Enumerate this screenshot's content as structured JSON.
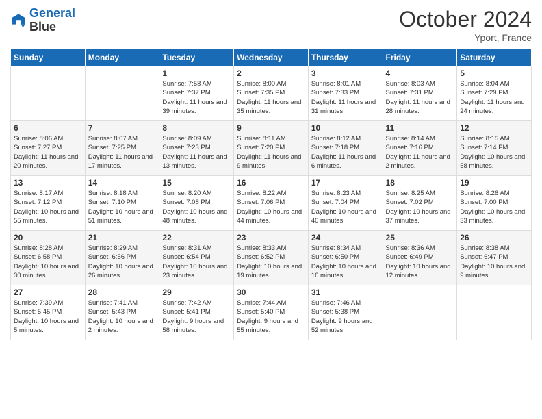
{
  "header": {
    "logo_line1": "General",
    "logo_line2": "Blue",
    "month": "October 2024",
    "location": "Yport, France"
  },
  "weekdays": [
    "Sunday",
    "Monday",
    "Tuesday",
    "Wednesday",
    "Thursday",
    "Friday",
    "Saturday"
  ],
  "weeks": [
    [
      {
        "day": "",
        "sunrise": "",
        "sunset": "",
        "daylight": ""
      },
      {
        "day": "",
        "sunrise": "",
        "sunset": "",
        "daylight": ""
      },
      {
        "day": "1",
        "sunrise": "Sunrise: 7:58 AM",
        "sunset": "Sunset: 7:37 PM",
        "daylight": "Daylight: 11 hours and 39 minutes."
      },
      {
        "day": "2",
        "sunrise": "Sunrise: 8:00 AM",
        "sunset": "Sunset: 7:35 PM",
        "daylight": "Daylight: 11 hours and 35 minutes."
      },
      {
        "day": "3",
        "sunrise": "Sunrise: 8:01 AM",
        "sunset": "Sunset: 7:33 PM",
        "daylight": "Daylight: 11 hours and 31 minutes."
      },
      {
        "day": "4",
        "sunrise": "Sunrise: 8:03 AM",
        "sunset": "Sunset: 7:31 PM",
        "daylight": "Daylight: 11 hours and 28 minutes."
      },
      {
        "day": "5",
        "sunrise": "Sunrise: 8:04 AM",
        "sunset": "Sunset: 7:29 PM",
        "daylight": "Daylight: 11 hours and 24 minutes."
      }
    ],
    [
      {
        "day": "6",
        "sunrise": "Sunrise: 8:06 AM",
        "sunset": "Sunset: 7:27 PM",
        "daylight": "Daylight: 11 hours and 20 minutes."
      },
      {
        "day": "7",
        "sunrise": "Sunrise: 8:07 AM",
        "sunset": "Sunset: 7:25 PM",
        "daylight": "Daylight: 11 hours and 17 minutes."
      },
      {
        "day": "8",
        "sunrise": "Sunrise: 8:09 AM",
        "sunset": "Sunset: 7:23 PM",
        "daylight": "Daylight: 11 hours and 13 minutes."
      },
      {
        "day": "9",
        "sunrise": "Sunrise: 8:11 AM",
        "sunset": "Sunset: 7:20 PM",
        "daylight": "Daylight: 11 hours and 9 minutes."
      },
      {
        "day": "10",
        "sunrise": "Sunrise: 8:12 AM",
        "sunset": "Sunset: 7:18 PM",
        "daylight": "Daylight: 11 hours and 6 minutes."
      },
      {
        "day": "11",
        "sunrise": "Sunrise: 8:14 AM",
        "sunset": "Sunset: 7:16 PM",
        "daylight": "Daylight: 11 hours and 2 minutes."
      },
      {
        "day": "12",
        "sunrise": "Sunrise: 8:15 AM",
        "sunset": "Sunset: 7:14 PM",
        "daylight": "Daylight: 10 hours and 58 minutes."
      }
    ],
    [
      {
        "day": "13",
        "sunrise": "Sunrise: 8:17 AM",
        "sunset": "Sunset: 7:12 PM",
        "daylight": "Daylight: 10 hours and 55 minutes."
      },
      {
        "day": "14",
        "sunrise": "Sunrise: 8:18 AM",
        "sunset": "Sunset: 7:10 PM",
        "daylight": "Daylight: 10 hours and 51 minutes."
      },
      {
        "day": "15",
        "sunrise": "Sunrise: 8:20 AM",
        "sunset": "Sunset: 7:08 PM",
        "daylight": "Daylight: 10 hours and 48 minutes."
      },
      {
        "day": "16",
        "sunrise": "Sunrise: 8:22 AM",
        "sunset": "Sunset: 7:06 PM",
        "daylight": "Daylight: 10 hours and 44 minutes."
      },
      {
        "day": "17",
        "sunrise": "Sunrise: 8:23 AM",
        "sunset": "Sunset: 7:04 PM",
        "daylight": "Daylight: 10 hours and 40 minutes."
      },
      {
        "day": "18",
        "sunrise": "Sunrise: 8:25 AM",
        "sunset": "Sunset: 7:02 PM",
        "daylight": "Daylight: 10 hours and 37 minutes."
      },
      {
        "day": "19",
        "sunrise": "Sunrise: 8:26 AM",
        "sunset": "Sunset: 7:00 PM",
        "daylight": "Daylight: 10 hours and 33 minutes."
      }
    ],
    [
      {
        "day": "20",
        "sunrise": "Sunrise: 8:28 AM",
        "sunset": "Sunset: 6:58 PM",
        "daylight": "Daylight: 10 hours and 30 minutes."
      },
      {
        "day": "21",
        "sunrise": "Sunrise: 8:29 AM",
        "sunset": "Sunset: 6:56 PM",
        "daylight": "Daylight: 10 hours and 26 minutes."
      },
      {
        "day": "22",
        "sunrise": "Sunrise: 8:31 AM",
        "sunset": "Sunset: 6:54 PM",
        "daylight": "Daylight: 10 hours and 23 minutes."
      },
      {
        "day": "23",
        "sunrise": "Sunrise: 8:33 AM",
        "sunset": "Sunset: 6:52 PM",
        "daylight": "Daylight: 10 hours and 19 minutes."
      },
      {
        "day": "24",
        "sunrise": "Sunrise: 8:34 AM",
        "sunset": "Sunset: 6:50 PM",
        "daylight": "Daylight: 10 hours and 16 minutes."
      },
      {
        "day": "25",
        "sunrise": "Sunrise: 8:36 AM",
        "sunset": "Sunset: 6:49 PM",
        "daylight": "Daylight: 10 hours and 12 minutes."
      },
      {
        "day": "26",
        "sunrise": "Sunrise: 8:38 AM",
        "sunset": "Sunset: 6:47 PM",
        "daylight": "Daylight: 10 hours and 9 minutes."
      }
    ],
    [
      {
        "day": "27",
        "sunrise": "Sunrise: 7:39 AM",
        "sunset": "Sunset: 5:45 PM",
        "daylight": "Daylight: 10 hours and 5 minutes."
      },
      {
        "day": "28",
        "sunrise": "Sunrise: 7:41 AM",
        "sunset": "Sunset: 5:43 PM",
        "daylight": "Daylight: 10 hours and 2 minutes."
      },
      {
        "day": "29",
        "sunrise": "Sunrise: 7:42 AM",
        "sunset": "Sunset: 5:41 PM",
        "daylight": "Daylight: 9 hours and 58 minutes."
      },
      {
        "day": "30",
        "sunrise": "Sunrise: 7:44 AM",
        "sunset": "Sunset: 5:40 PM",
        "daylight": "Daylight: 9 hours and 55 minutes."
      },
      {
        "day": "31",
        "sunrise": "Sunrise: 7:46 AM",
        "sunset": "Sunset: 5:38 PM",
        "daylight": "Daylight: 9 hours and 52 minutes."
      },
      {
        "day": "",
        "sunrise": "",
        "sunset": "",
        "daylight": ""
      },
      {
        "day": "",
        "sunrise": "",
        "sunset": "",
        "daylight": ""
      }
    ]
  ]
}
